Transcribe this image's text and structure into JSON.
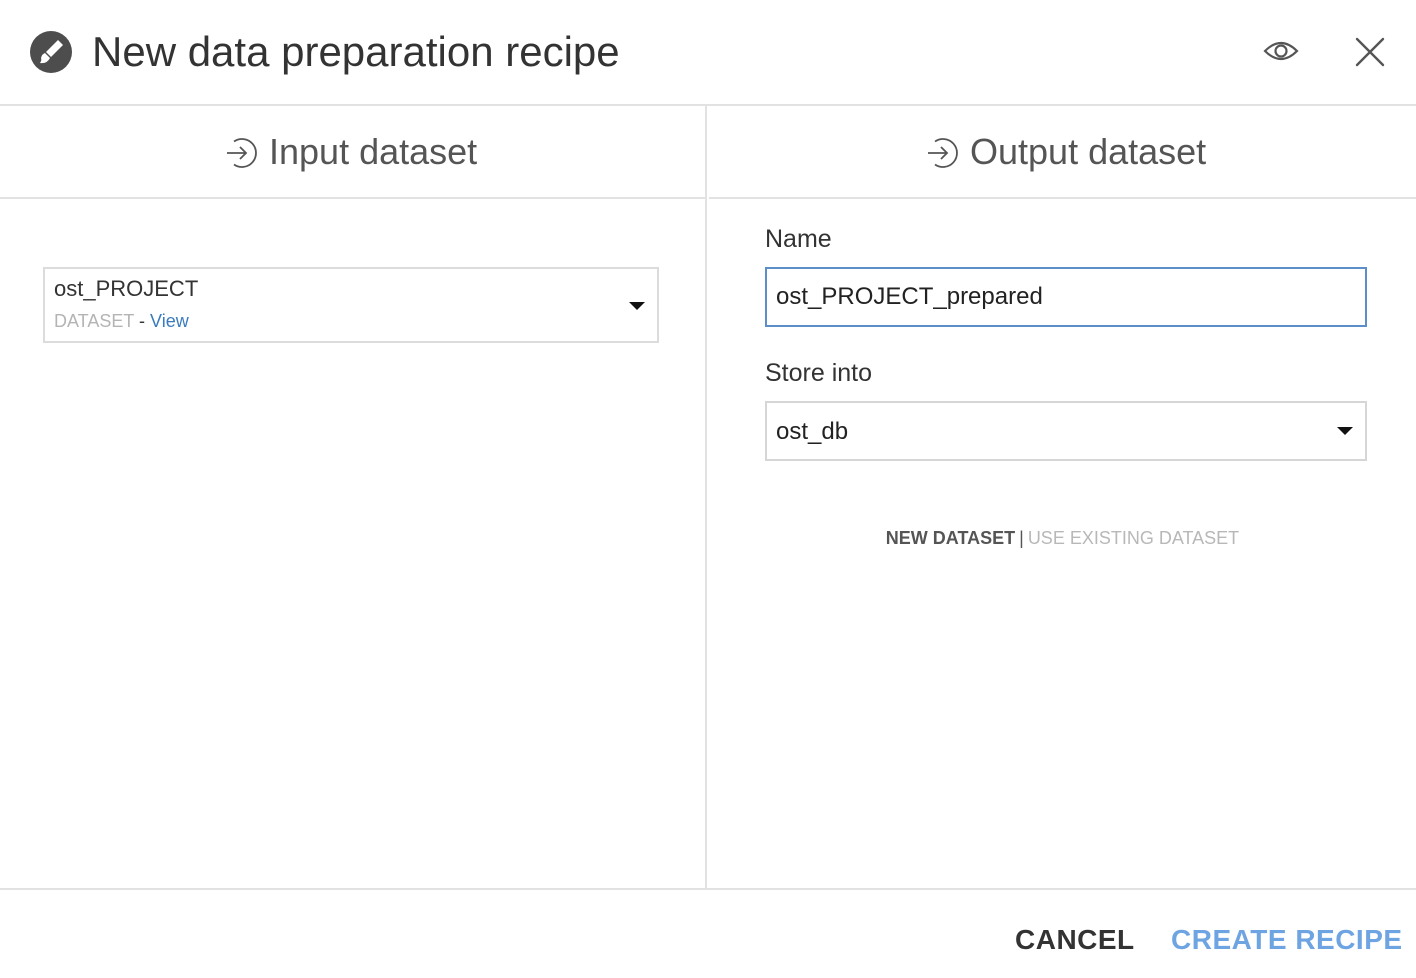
{
  "header": {
    "title": "New data preparation recipe",
    "icon": "brush-icon",
    "actions": [
      "eye-icon",
      "close-icon"
    ]
  },
  "input": {
    "heading": "Input dataset",
    "dataset": {
      "name": "ost_PROJECT",
      "type": "DATASET",
      "separator": " - ",
      "view_link": "View"
    }
  },
  "output": {
    "heading": "Output dataset",
    "name_label": "Name",
    "name_value": "ost_PROJECT_prepared",
    "store_label": "Store into",
    "store_value": "ost_db",
    "mode_new": "NEW DATASET",
    "mode_separator": "|",
    "mode_existing": "USE EXISTING DATASET"
  },
  "footer": {
    "cancel_label": "CANCEL",
    "create_label": "CREATE RECIPE"
  },
  "colors": {
    "accent": "#3a7bbd",
    "create_button": "#6fa4e2",
    "input_focus_border": "#5c8fc8",
    "divider": "#e2e2e2"
  }
}
